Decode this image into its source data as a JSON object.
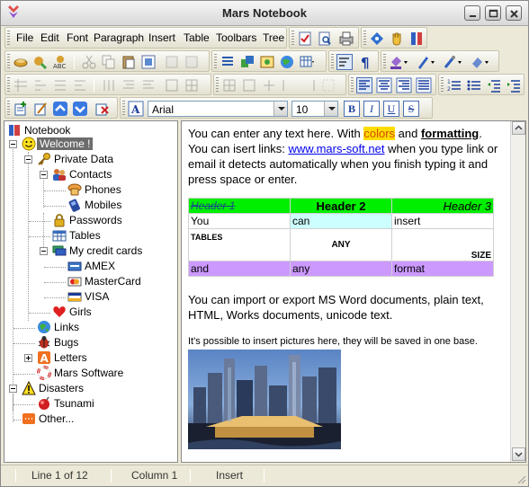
{
  "window": {
    "title": "Mars Notebook"
  },
  "menu": [
    "File",
    "Edit",
    "Font",
    "Paragraph",
    "Insert",
    "Table",
    "Toolbars",
    "Tree"
  ],
  "font_bar": {
    "font_name": "Arial",
    "font_size": "10",
    "styles": [
      "B",
      "I",
      "U",
      "S"
    ]
  },
  "tree": {
    "nodes": [
      {
        "label": "Notebook",
        "icon": "notebook-icon"
      },
      {
        "label": "Welcome !",
        "icon": "smiley-icon"
      },
      {
        "label": "Private Data",
        "icon": "key-icon"
      },
      {
        "label": "Contacts",
        "icon": "people-icon"
      },
      {
        "label": "Phones",
        "icon": "phone-icon"
      },
      {
        "label": "Mobiles",
        "icon": "mobile-icon"
      },
      {
        "label": "Passwords",
        "icon": "lock-icon"
      },
      {
        "label": "Tables",
        "icon": "table-icon"
      },
      {
        "label": "My credit cards",
        "icon": "cards-icon"
      },
      {
        "label": "AMEX",
        "icon": "credit-card-icon"
      },
      {
        "label": "MasterCard",
        "icon": "credit-card-icon"
      },
      {
        "label": "VISA",
        "icon": "credit-card-icon"
      },
      {
        "label": "Girls",
        "icon": "heart-icon"
      },
      {
        "label": "Links",
        "icon": "globe-icon"
      },
      {
        "label": "Bugs",
        "icon": "bug-icon"
      },
      {
        "label": "Letters",
        "icon": "letter-a-icon"
      },
      {
        "label": "Mars Software",
        "icon": "lifebuoy-icon"
      },
      {
        "label": "Disasters",
        "icon": "warning-icon"
      },
      {
        "label": "Tsunami",
        "icon": "bomb-icon"
      },
      {
        "label": "Other...",
        "icon": "box-icon"
      }
    ]
  },
  "editor": {
    "intro_1": "You can enter any text here. With ",
    "colors_word": "colors",
    "intro_and": " and ",
    "formatting_word": "formatting",
    "intro_dot": ".",
    "links_pre": "You can isert links: ",
    "link": "www.mars-soft.net",
    "links_post": " when you type link or email it detects automatically when you finish typing it and press space or enter.",
    "table": {
      "header": [
        "Header 1",
        "Header 2",
        "Header 3"
      ],
      "row1": [
        "You",
        "can",
        "insert"
      ],
      "row2": [
        "TABLES",
        "ANY",
        "SIZE"
      ],
      "row3": [
        "and",
        "any",
        "format"
      ]
    },
    "import_text": "You can import or export MS Word documents, plain text, HTML, Works documents, unicode text.",
    "pictures_text": "It's possible to insert pictures here, they will be saved in one base."
  },
  "status": {
    "line": "Line 1 of 12",
    "column": "Column 1",
    "mode": "Insert"
  },
  "colors": {
    "header_green": "#00ee00",
    "cyan_cell": "#ccffff",
    "purple_row": "#cc99ff",
    "selection": "#6c6c6c",
    "highlight": "#ffdd00"
  }
}
